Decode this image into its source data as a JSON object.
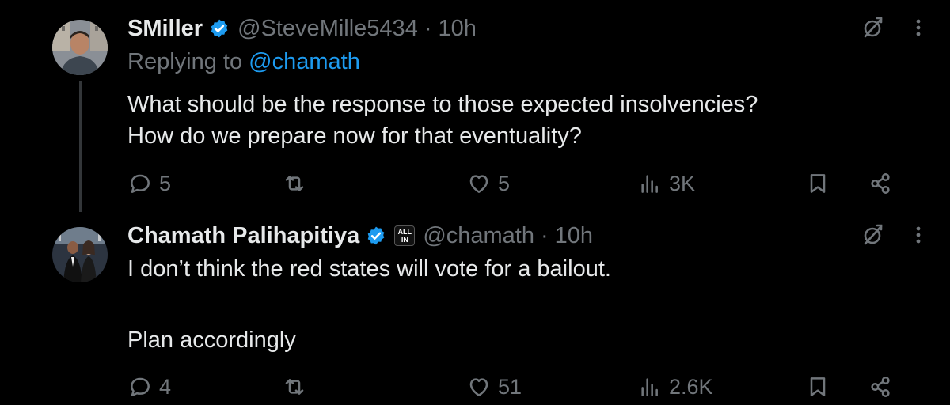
{
  "tweets": [
    {
      "name": "SMiller",
      "handle": "@SteveMille5434",
      "dot": "·",
      "time": "10h",
      "replying_prefix": "Replying to ",
      "replying_mention": "@chamath",
      "body": "What should be the response to those expected insolvencies?\nHow do we prepare now for that eventuality?",
      "replies": "5",
      "reposts": "",
      "likes": "5",
      "views": "3K",
      "icons": [
        "reply-icon",
        "repost-icon",
        "like-icon",
        "views-icon",
        "bookmark-icon",
        "share-icon",
        "grok-icon",
        "more-icon",
        "verified-badge-icon"
      ]
    },
    {
      "name": "Chamath Palihapitiya",
      "handle": "@chamath",
      "dot": "·",
      "time": "10h",
      "affiliation_line1": "ALL",
      "affiliation_line2": "IN",
      "body": "I don’t think the red states will vote for a bailout.\n\nPlan accordingly",
      "replies": "4",
      "reposts": "",
      "likes": "51",
      "views": "2.6K",
      "icons": [
        "reply-icon",
        "repost-icon",
        "like-icon",
        "views-icon",
        "bookmark-icon",
        "share-icon",
        "grok-icon",
        "more-icon",
        "verified-badge-icon",
        "affiliation-badge-icon"
      ]
    }
  ],
  "colors": {
    "background": "#000000",
    "text": "#e7e9ea",
    "muted": "#71767b",
    "link": "#1d9bf0",
    "verified": "#1d9bf0",
    "thread_line": "#333639"
  }
}
